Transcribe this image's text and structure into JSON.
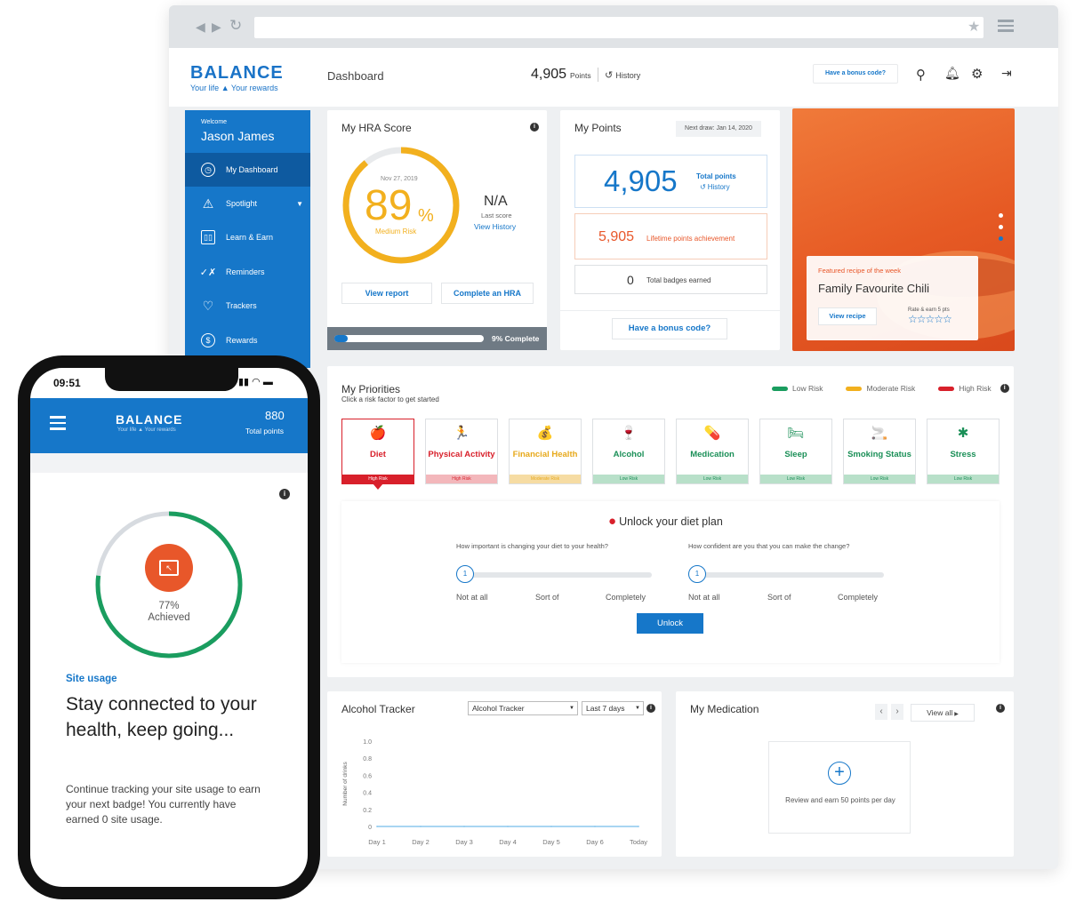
{
  "app": {
    "logo": "BALANCE",
    "tagline": "Your life ▲ Your rewards",
    "page_title": "Dashboard",
    "points_value": "4,905",
    "points_label": "Points",
    "history_label": "History",
    "bonus_code_label": "Have a bonus code?"
  },
  "sidebar": {
    "welcome": "Welcome",
    "user_name": "Jason James",
    "items": [
      {
        "label": "My Dashboard",
        "icon": "dashboard-icon"
      },
      {
        "label": "Spotlight",
        "icon": "spotlight-icon"
      },
      {
        "label": "Learn & Earn",
        "icon": "book-icon"
      },
      {
        "label": "Reminders",
        "icon": "checklist-icon"
      },
      {
        "label": "Trackers",
        "icon": "heartbeat-icon"
      },
      {
        "label": "Rewards",
        "icon": "dollar-icon"
      }
    ]
  },
  "hra": {
    "title": "My HRA Score",
    "date": "Nov 27, 2019",
    "score": "89",
    "score_unit": "%",
    "risk": "Medium Risk",
    "last_score_value": "N/A",
    "last_score_label": "Last score",
    "view_history": "View History",
    "view_report": "View report",
    "complete_hra": "Complete an HRA",
    "progress_label": "9% Complete",
    "progress_fraction": 0.09
  },
  "points": {
    "title": "My Points",
    "next_draw": "Next draw: Jan 14, 2020",
    "total_value": "4,905",
    "total_label": "Total points",
    "history": "History",
    "lifetime_value": "5,905",
    "lifetime_label": "Lifetime points achievement",
    "badges_value": "0",
    "badges_label": "Total badges earned",
    "bonus_code": "Have a bonus code?"
  },
  "recipe": {
    "kicker": "Featured recipe of the week",
    "title": "Family Favourite Chili",
    "view_recipe": "View recipe",
    "rate_label": "Rate & earn 5 pts",
    "stars": "☆☆☆☆☆"
  },
  "priorities": {
    "title": "My Priorities",
    "subtitle": "Click a risk factor to get started",
    "legend": [
      {
        "label": "Low Risk",
        "color": "#1a9d5f"
      },
      {
        "label": "Moderate Risk",
        "color": "#f2b01e"
      },
      {
        "label": "High Risk",
        "color": "#d8202b"
      }
    ],
    "items": [
      {
        "label": "Diet",
        "risk": "High Risk",
        "icon": "apple-icon",
        "glyph": "🍎",
        "color": "#d8202b",
        "bar": "#d8202b",
        "tint": "#d8202b",
        "selected": true
      },
      {
        "label": "Physical Activity",
        "risk": "High Risk",
        "icon": "runner-icon",
        "glyph": "🏃",
        "color": "#d8202b",
        "bar": "#f3b7bb",
        "tint": "#d8202b",
        "selected": false
      },
      {
        "label": "Financial Health",
        "risk": "Moderate Risk",
        "icon": "money-hand-icon",
        "glyph": "💰",
        "color": "#e7a91b",
        "bar": "#f6dca3",
        "tint": "#e7a91b",
        "selected": false
      },
      {
        "label": "Alcohol",
        "risk": "Low Risk",
        "icon": "bottle-icon",
        "glyph": "🍷",
        "color": "#1a8f57",
        "bar": "#b8e0c9",
        "tint": "#1a8f57",
        "selected": false
      },
      {
        "label": "Medication",
        "risk": "Low Risk",
        "icon": "pills-icon",
        "glyph": "💊",
        "color": "#1a8f57",
        "bar": "#b8e0c9",
        "tint": "#1a8f57",
        "selected": false
      },
      {
        "label": "Sleep",
        "risk": "Low Risk",
        "icon": "bed-icon",
        "glyph": "🛏",
        "color": "#1a8f57",
        "bar": "#b8e0c9",
        "tint": "#1a8f57",
        "selected": false
      },
      {
        "label": "Smoking Status",
        "risk": "Low Risk",
        "icon": "cigarette-icon",
        "glyph": "🚬",
        "color": "#1a8f57",
        "bar": "#b8e0c9",
        "tint": "#1a8f57",
        "selected": false
      },
      {
        "label": "Stress",
        "risk": "Low Risk",
        "icon": "stress-icon",
        "glyph": "✱",
        "color": "#1a8f57",
        "bar": "#b8e0c9",
        "tint": "#1a8f57",
        "selected": false
      }
    ],
    "unlock_title": "Unlock your diet plan",
    "q1": "How important is changing your diet to your health?",
    "q2": "How confident are you that you can make the change?",
    "slider_value": "1",
    "scale": [
      "Not at all",
      "Sort of",
      "Completely"
    ],
    "unlock_button": "Unlock"
  },
  "alcohol": {
    "title": "Alcohol Tracker",
    "select_tracker": "Alcohol Tracker",
    "select_range": "Last 7 days",
    "ylabel": "Number of drinks",
    "chart_data": {
      "type": "line",
      "x": [
        "Day 1",
        "Day 2",
        "Day 3",
        "Day 4",
        "Day 5",
        "Day 6",
        "Today"
      ],
      "y_ticks": [
        "1.0",
        "0.8",
        "0.6",
        "0.4",
        "0.2",
        "0"
      ],
      "values": [
        0,
        0,
        0,
        0,
        0,
        0,
        0
      ],
      "ylim": [
        0,
        1.0
      ],
      "ylabel": "Number of drinks"
    }
  },
  "medication": {
    "title": "My Medication",
    "view_all": "View all",
    "prompt": "Review and earn 50 points per day"
  },
  "phone": {
    "time": "09:51",
    "logo": "BALANCE",
    "tagline": "Your life ▲ Your rewards",
    "points_value": "880",
    "points_label": "Total points",
    "progress_percent": "77%",
    "progress_label": "Achieved",
    "progress_fraction": 0.77,
    "kicker": "Site usage",
    "headline": "Stay connected to your health, keep going...",
    "body": "Continue tracking your site usage to earn your next badge! You currently have earned 0 site usage."
  },
  "colors": {
    "brand_blue": "#1677c9",
    "hra_ring": "#f2b01e",
    "progress_green": "#1a9d5f",
    "orange": "#e8572a"
  }
}
